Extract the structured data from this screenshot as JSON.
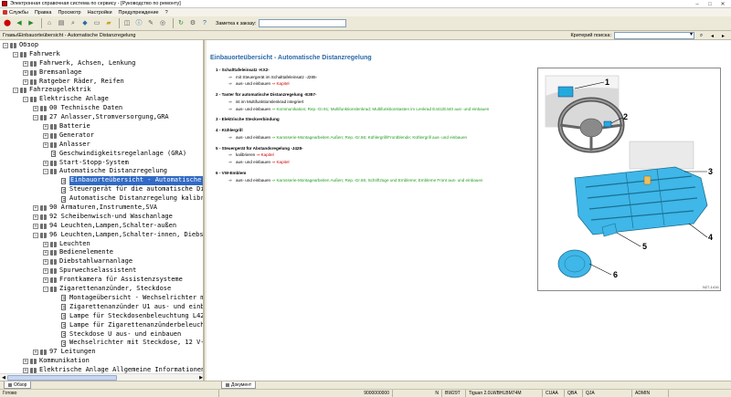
{
  "window": {
    "title": "Электронная справочная система по сервису - [Руководство по ремонту]"
  },
  "menu": [
    "Службы",
    "Правка",
    "Просмотр",
    "Настройки",
    "Предупреждение",
    "?"
  ],
  "toolbar": {
    "order_label": "Заметка к заказу:",
    "order_value": ""
  },
  "pathbar": {
    "path": "Главы\\Einbauorteübersicht - Automatische Distanzregelung"
  },
  "search": {
    "label": "Критерий поиска:",
    "value": ""
  },
  "tree": [
    {
      "indent": 0,
      "exp": "−",
      "icon": "book",
      "label": "Обзор"
    },
    {
      "indent": 1,
      "exp": "−",
      "icon": "book",
      "label": "Fahrwerk"
    },
    {
      "indent": 2,
      "exp": "+",
      "icon": "book",
      "label": "Fahrwerk, Achsen, Lenkung"
    },
    {
      "indent": 2,
      "exp": "+",
      "icon": "book",
      "label": "Bremsanlage"
    },
    {
      "indent": 2,
      "exp": "+",
      "icon": "book",
      "label": "Ratgeber Räder, Reifen"
    },
    {
      "indent": 1,
      "exp": "−",
      "icon": "book",
      "label": "Fahrzeugelektrik"
    },
    {
      "indent": 2,
      "exp": "−",
      "icon": "book",
      "label": "Elektrische Anlage"
    },
    {
      "indent": 3,
      "exp": "+",
      "icon": "book",
      "label": "00 Technische Daten"
    },
    {
      "indent": 3,
      "exp": "−",
      "icon": "book",
      "label": "27 Anlasser,Stromversorgung,GRA"
    },
    {
      "indent": 4,
      "exp": "+",
      "icon": "book",
      "label": "Batterie"
    },
    {
      "indent": 4,
      "exp": "+",
      "icon": "book",
      "label": "Generator"
    },
    {
      "indent": 4,
      "exp": "+",
      "icon": "book",
      "label": "Anlasser"
    },
    {
      "indent": 4,
      "exp": "",
      "icon": "doc",
      "label": "Geschwindigkeitsregelanlage (GRA)"
    },
    {
      "indent": 4,
      "exp": "+",
      "icon": "book",
      "label": "Start-Stopp-System"
    },
    {
      "indent": 4,
      "exp": "−",
      "icon": "book",
      "label": "Automatische Distanzregelung"
    },
    {
      "indent": 5,
      "exp": "",
      "icon": "doc",
      "label": "Einbauorteübersicht - Automatische Dista",
      "selected": true
    },
    {
      "indent": 5,
      "exp": "",
      "icon": "doc",
      "label": "Steuergerät für die automatische Distanz"
    },
    {
      "indent": 5,
      "exp": "",
      "icon": "doc",
      "label": "Automatische Distanzregelung kalibrieren"
    },
    {
      "indent": 3,
      "exp": "+",
      "icon": "book",
      "label": "90 Armaturen,Instrumente,SVA"
    },
    {
      "indent": 3,
      "exp": "+",
      "icon": "book",
      "label": "92 Scheibenwisch-und Waschanlage"
    },
    {
      "indent": 3,
      "exp": "+",
      "icon": "book",
      "label": "94 Leuchten,Lampen,Schalter-außen"
    },
    {
      "indent": 3,
      "exp": "−",
      "icon": "book",
      "label": "96 Leuchten,Lampen,Schalter-innen, Diebstahl"
    },
    {
      "indent": 4,
      "exp": "+",
      "icon": "book",
      "label": "Leuchten"
    },
    {
      "indent": 4,
      "exp": "+",
      "icon": "book",
      "label": "Bedienelemente"
    },
    {
      "indent": 4,
      "exp": "+",
      "icon": "book",
      "label": "Diebstahlwarnanlage"
    },
    {
      "indent": 4,
      "exp": "+",
      "icon": "book",
      "label": "Spurwechselassistent"
    },
    {
      "indent": 4,
      "exp": "+",
      "icon": "book",
      "label": "Frontkamera für Assistenzsysteme"
    },
    {
      "indent": 4,
      "exp": "−",
      "icon": "book",
      "label": "Zigarettenanzünder, Steckdose"
    },
    {
      "indent": 5,
      "exp": "",
      "icon": "doc",
      "label": "Montageübersicht - Wechselrichter mit St"
    },
    {
      "indent": 5,
      "exp": "",
      "icon": "doc",
      "label": "Zigarettenanzünder U1 aus- und einbauen"
    },
    {
      "indent": 5,
      "exp": "",
      "icon": "doc",
      "label": "Lampe für Steckdosenbeleuchtung L42 aus"
    },
    {
      "indent": 5,
      "exp": "",
      "icon": "doc",
      "label": "Lampe für Zigarettenanzünderbeleuchtung"
    },
    {
      "indent": 5,
      "exp": "",
      "icon": "doc",
      "label": "Steckdose U aus- und einbauen"
    },
    {
      "indent": 5,
      "exp": "",
      "icon": "doc",
      "label": "Wechselrichter mit Steckdose, 12 V-230 V"
    },
    {
      "indent": 3,
      "exp": "+",
      "icon": "book",
      "label": "97 Leitungen"
    },
    {
      "indent": 2,
      "exp": "+",
      "icon": "book",
      "label": "Kommunikation"
    },
    {
      "indent": 2,
      "exp": "+",
      "icon": "book",
      "label": "Elektrische Anlage Allgemeine Informationen"
    },
    {
      "indent": 1,
      "exp": "+",
      "icon": "book",
      "label": "Heizung-Lüftung-Klimaanlage"
    }
  ],
  "left_tab": {
    "label": "Обзор"
  },
  "right_tab": {
    "label": "Документ"
  },
  "document": {
    "title": "Einbauorteübersicht - Automatische Distanzregelung",
    "items": [
      {
        "head": "1 - Schalttafeleinsatz -KX2-",
        "subs": [
          {
            "parts": [
              {
                "t": "mit Steuergerät im Schalttafeleinsatz -J285-",
                "c": ""
              }
            ]
          },
          {
            "parts": [
              {
                "t": "aus- und einbauen ",
                "c": ""
              },
              {
                "t": "⇒ Kapitel",
                "c": "red"
              }
            ]
          }
        ]
      },
      {
        "head": "2 - Taster für automatische Distanzregelung -E357-",
        "subs": [
          {
            "parts": [
              {
                "t": "ist im Multifunktionslenkrad integriert",
                "c": ""
              }
            ]
          },
          {
            "parts": [
              {
                "t": "aus- und einbauen ",
                "c": ""
              },
              {
                "t": "⇒ Kommunikation; Rep.-Gr.91; Multifunktionslenkrad; Multifunktionstasten im Lenkrad E441/E440 aus- und einbauen",
                "c": "grn"
              }
            ]
          }
        ]
      },
      {
        "head": "3 - Elektrische Steckverbindung",
        "subs": []
      },
      {
        "head": "4 - Kühlergrill",
        "subs": [
          {
            "parts": [
              {
                "t": "aus- und einbauen ",
                "c": ""
              },
              {
                "t": "⇒ Karosserie-Montagearbeiten Außen; Rep.-Gr.66; Kühlergrill/Frontblende; Kühlergrill aus- und einbauen",
                "c": "grn"
              }
            ]
          }
        ]
      },
      {
        "head": "5 - Steuergerät für Abstandsregelung -J428-",
        "subs": [
          {
            "parts": [
              {
                "t": "kalibrieren ",
                "c": ""
              },
              {
                "t": "⇒ Kapitel",
                "c": "red"
              }
            ]
          },
          {
            "parts": [
              {
                "t": "aus- und einbauen ",
                "c": ""
              },
              {
                "t": "⇒ Kapitel",
                "c": "red"
              }
            ]
          }
        ]
      },
      {
        "head": "6 - VW-Emblem",
        "subs": [
          {
            "parts": [
              {
                "t": "aus- und einbauen ",
                "c": ""
              },
              {
                "t": "⇒ Karosserie-Montagearbeiten Außen; Rep.-Gr.66; Schriftzüge und Embleme; Embleme Front aus- und einbauen",
                "c": "grn"
              }
            ]
          }
        ]
      }
    ]
  },
  "figure": {
    "callouts": [
      "1",
      "2",
      "3",
      "4",
      "5",
      "6"
    ],
    "code": "N27-1416"
  },
  "status": [
    "Готово",
    "9000000000",
    "N",
    "BW29T",
    "Tiguan 2.0LWBHLBM74M",
    "CUAA",
    "QBA",
    "QJA",
    "ADMIN"
  ]
}
